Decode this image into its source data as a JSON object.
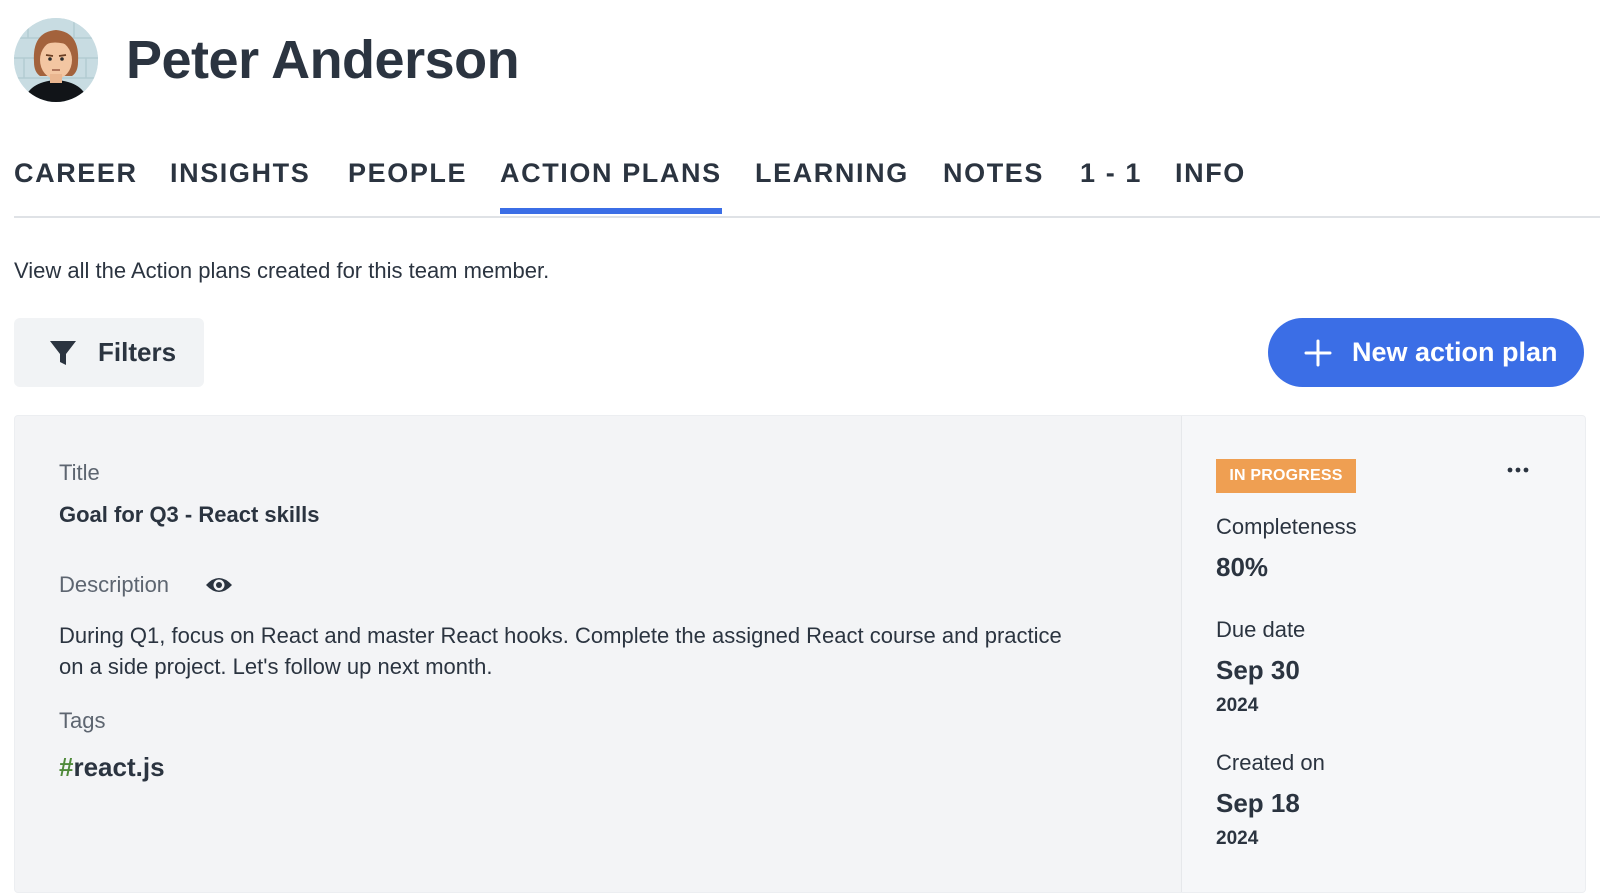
{
  "profile": {
    "name": "Peter Anderson",
    "avatar_icon": "person-avatar"
  },
  "tabs": [
    {
      "label": "CAREER"
    },
    {
      "label": "INSIGHTS"
    },
    {
      "label": "PEOPLE"
    },
    {
      "label": "ACTION PLANS",
      "active": true
    },
    {
      "label": "LEARNING"
    },
    {
      "label": "NOTES"
    },
    {
      "label": "1 - 1"
    },
    {
      "label": "INFO"
    }
  ],
  "intro_text": "View all the Action plans created for this team member.",
  "toolbar": {
    "filters_label": "Filters",
    "filters_icon": "filter-funnel-icon",
    "new_plan_label": "New action plan",
    "new_plan_icon": "plus-icon"
  },
  "plan": {
    "title_label": "Title",
    "title": "Goal for Q3 - React skills",
    "description_label": "Description",
    "description": "During Q1, focus on React and master React hooks. Complete the assigned React course and practice on a side project. Let's follow up next month.",
    "tags_label": "Tags",
    "tags": [
      {
        "hash": "#",
        "name": "react.js"
      }
    ],
    "status": "IN PROGRESS",
    "completeness_label": "Completeness",
    "completeness": "80%",
    "due_label": "Due date",
    "due_date": "Sep 30",
    "due_year": "2024",
    "created_label": "Created on",
    "created_date": "Sep 18",
    "created_year": "2024"
  },
  "colors": {
    "accent": "#3b6ee6",
    "status_in_progress": "#ef9f52",
    "tag_hash": "#4f8a3a",
    "text": "#2b3440"
  }
}
